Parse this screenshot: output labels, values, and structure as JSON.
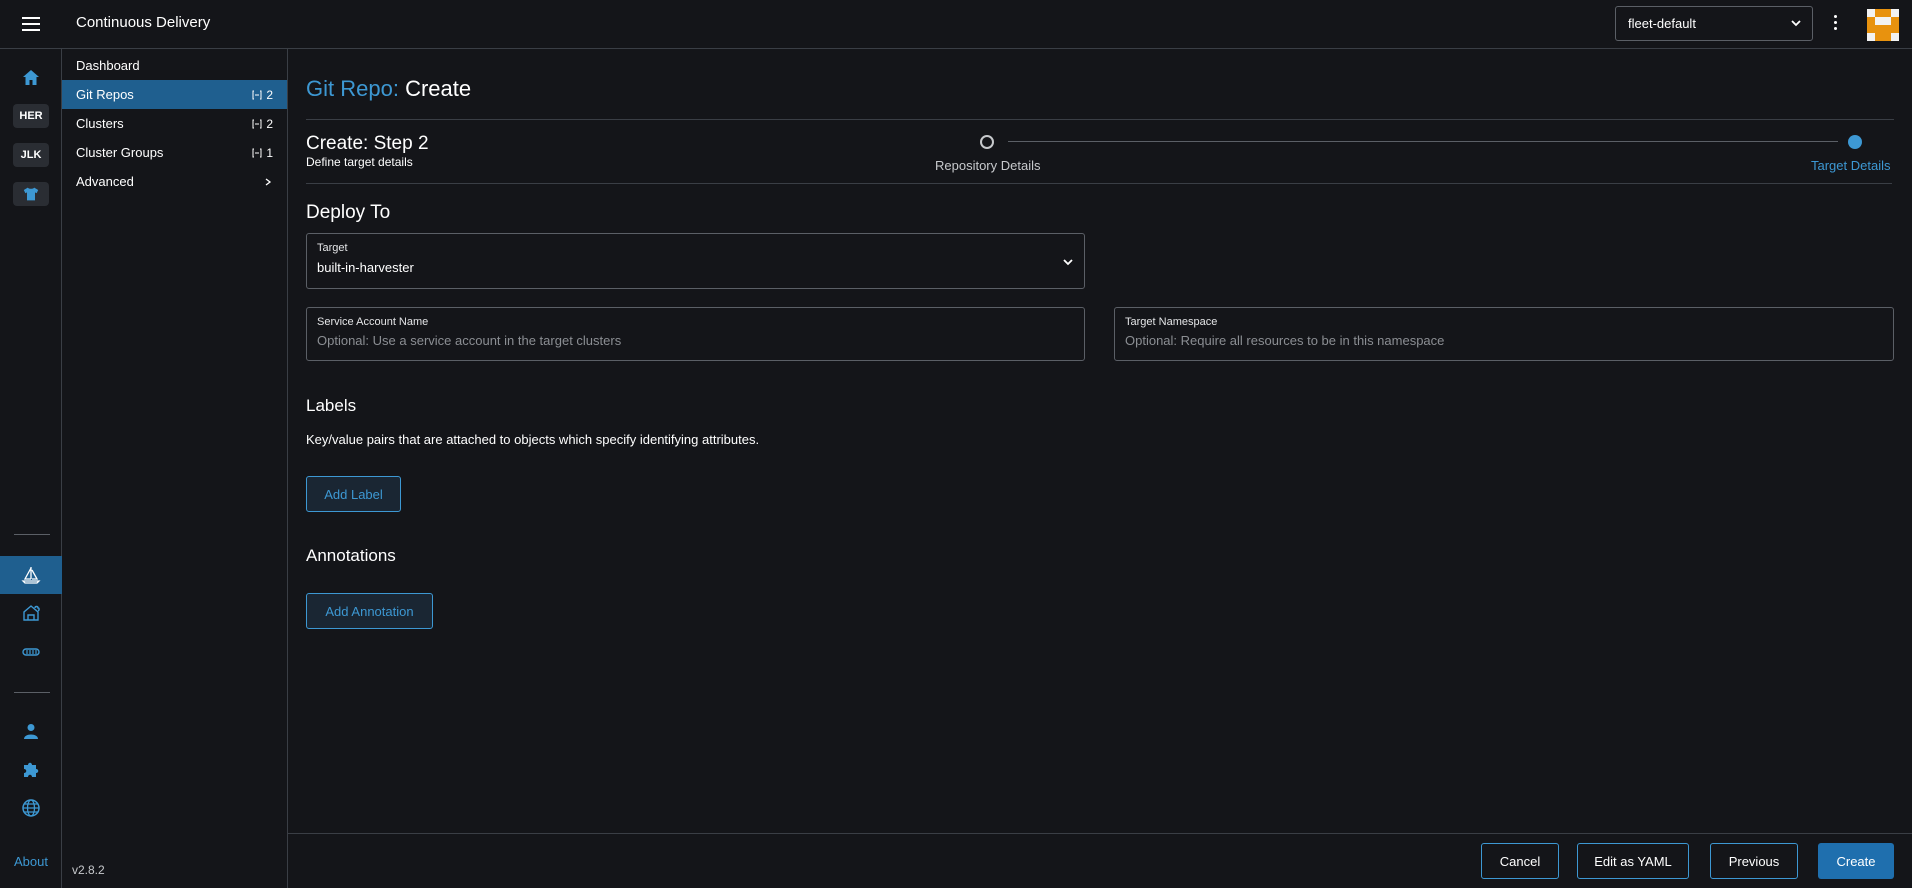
{
  "header": {
    "title": "Continuous Delivery",
    "workspace": "fleet-default"
  },
  "colors": {
    "accent": "#3d98d3",
    "active_bg": "#1f5f8f",
    "primary_button": "#1f6fae",
    "background": "#141519"
  },
  "rail": {
    "badges": [
      "HER",
      "JLK"
    ],
    "icons": [
      "home-icon",
      "shirt-icon",
      "sailboat-icon",
      "house-cloud-icon",
      "network-icon",
      "user-icon",
      "puzzle-icon",
      "globe-icon"
    ],
    "about": "About"
  },
  "sidebar": {
    "items": [
      {
        "label": "Dashboard",
        "count": ""
      },
      {
        "label": "Git Repos",
        "count": "2"
      },
      {
        "label": "Clusters",
        "count": "2"
      },
      {
        "label": "Cluster Groups",
        "count": "1"
      },
      {
        "label": "Advanced",
        "count": ""
      }
    ],
    "version": "v2.8.2"
  },
  "page": {
    "crumb": "Git Repo:",
    "title": "Create",
    "step_title": "Create: Step 2",
    "step_subtitle": "Define target details",
    "steps": [
      "Repository Details",
      "Target Details"
    ],
    "deploy_heading": "Deploy To",
    "target": {
      "label": "Target",
      "value": "built-in-harvester"
    },
    "service_account": {
      "label": "Service Account Name",
      "placeholder": "Optional: Use a service account in the target clusters"
    },
    "target_namespace": {
      "label": "Target Namespace",
      "placeholder": "Optional: Require all resources to be in this namespace"
    },
    "labels_heading": "Labels",
    "labels_description": "Key/value pairs that are attached to objects which specify identifying attributes.",
    "add_label": "Add Label",
    "annotations_heading": "Annotations",
    "add_annotation": "Add Annotation"
  },
  "footer": {
    "cancel": "Cancel",
    "edit_yaml": "Edit as YAML",
    "previous": "Previous",
    "create": "Create"
  }
}
